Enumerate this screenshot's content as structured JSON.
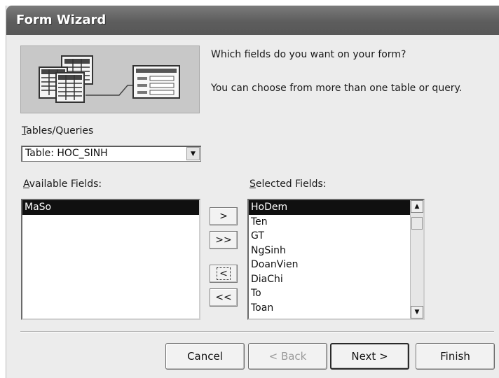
{
  "window": {
    "title": "Form Wizard"
  },
  "prompt": {
    "line1": "Which fields do you want on your form?",
    "line2": "You can choose from more than one table or query."
  },
  "tables_queries": {
    "label": "Tables/Queries",
    "selected": "Table: HOC_SINH"
  },
  "available_fields": {
    "label": "Available Fields:",
    "items": [
      "MaSo"
    ],
    "selected_index": 0
  },
  "selected_fields": {
    "label": "Selected Fields:",
    "items": [
      "HoDem",
      "Ten",
      "GT",
      "NgSinh",
      "DoanVien",
      "DiaChi",
      "To",
      "Toan"
    ],
    "selected_index": 0
  },
  "move_buttons": {
    "add_one": ">",
    "add_all": ">>",
    "remove_one": "<",
    "remove_all": "<<"
  },
  "footer": {
    "cancel": "Cancel",
    "back": "< Back",
    "next": "Next >",
    "finish": "Finish"
  },
  "icons": {
    "combo_dropdown": "chevron-down-icon",
    "scroll_up": "arrow-up-icon",
    "scroll_down": "arrow-down-icon",
    "wizard_graphic": "form-wizard-illustration"
  }
}
